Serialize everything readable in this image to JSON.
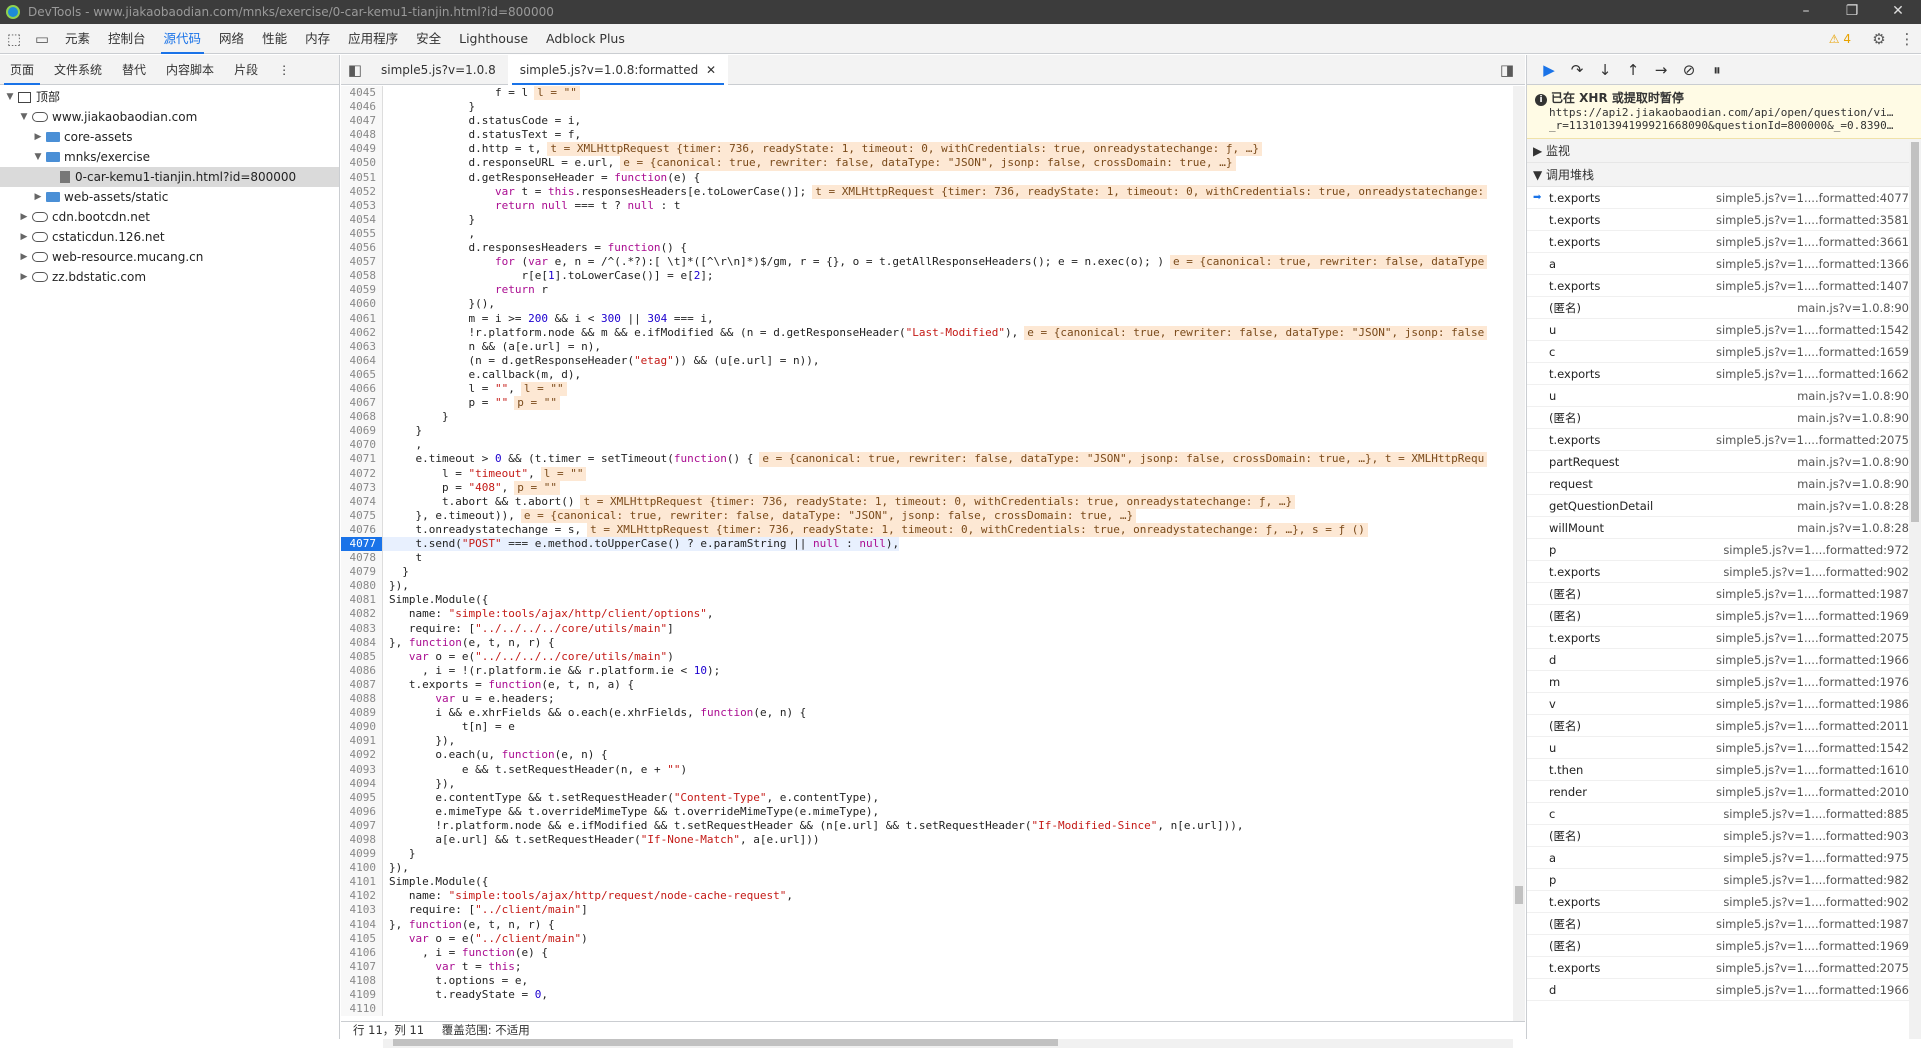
{
  "window": {
    "title": "DevTools - www.jiakaobaodian.com/mnks/exercise/0-car-kemu1-tianjin.html?id=800000"
  },
  "toolbar": {
    "tabs": [
      "元素",
      "控制台",
      "源代码",
      "网络",
      "性能",
      "内存",
      "应用程序",
      "安全",
      "Lighthouse",
      "Adblock Plus"
    ],
    "active_tab": "源代码",
    "warnings": "4"
  },
  "navigator": {
    "tabs": [
      "页面",
      "文件系统",
      "替代",
      "内容脚本",
      "片段"
    ],
    "tree": [
      {
        "label": "顶部",
        "type": "top",
        "depth": 0,
        "arrow": "▼"
      },
      {
        "label": "www.jiakaobaodian.com",
        "type": "cloud",
        "depth": 1,
        "arrow": "▼"
      },
      {
        "label": "core-assets",
        "type": "folder",
        "depth": 2,
        "arrow": "▶"
      },
      {
        "label": "mnks/exercise",
        "type": "folder",
        "depth": 2,
        "arrow": "▼"
      },
      {
        "label": "0-car-kemu1-tianjin.html?id=800000",
        "type": "file",
        "depth": 3,
        "arrow": "",
        "selected": true
      },
      {
        "label": "web-assets/static",
        "type": "folder",
        "depth": 2,
        "arrow": "▶"
      },
      {
        "label": "cdn.bootcdn.net",
        "type": "cloud",
        "depth": 1,
        "arrow": "▶"
      },
      {
        "label": "cstaticdun.126.net",
        "type": "cloud",
        "depth": 1,
        "arrow": "▶"
      },
      {
        "label": "web-resource.mucang.cn",
        "type": "cloud",
        "depth": 1,
        "arrow": "▶"
      },
      {
        "label": "zz.bdstatic.com",
        "type": "cloud",
        "depth": 1,
        "arrow": "▶"
      }
    ]
  },
  "editor": {
    "tabs": [
      {
        "label": "simple5.js?v=1.0.8",
        "active": false,
        "closable": false
      },
      {
        "label": "simple5.js?v=1.0.8:formatted",
        "active": true,
        "closable": true
      }
    ],
    "current_line": 4077,
    "lines": [
      [
        "4045",
        "                f = l",
        "l = \"\""
      ],
      [
        "4046",
        "            }",
        ""
      ],
      [
        "4047",
        "            d.statusCode = i,",
        ""
      ],
      [
        "4048",
        "            d.statusText = f,",
        ""
      ],
      [
        "4049",
        "            d.http = t,",
        "t = XMLHttpRequest {timer: 736, readyState: 1, timeout: 0, withCredentials: true, onreadystatechange: ƒ, …}"
      ],
      [
        "4050",
        "            d.responseURL = e.url,",
        "e = {canonical: true, rewriter: false, dataType: \"JSON\", jsonp: false, crossDomain: true, …}"
      ],
      [
        "4051",
        "            d.getResponseHeader = function(e) {",
        ""
      ],
      [
        "4052",
        "                var t = this.responsesHeaders[e.toLowerCase()];",
        "t = XMLHttpRequest {timer: 736, readyState: 1, timeout: 0, withCredentials: true, onreadystatechange:"
      ],
      [
        "4053",
        "                return null === t ? null : t",
        ""
      ],
      [
        "4054",
        "            }",
        ""
      ],
      [
        "4055",
        "            ,",
        ""
      ],
      [
        "4056",
        "            d.responsesHeaders = function() {",
        ""
      ],
      [
        "4057",
        "                for (var e, n = /^(.*?):[ \\t]*([^\\r\\n]*)$/gm, r = {}, o = t.getAllResponseHeaders(); e = n.exec(o); )",
        "e = {canonical: true, rewriter: false, dataType"
      ],
      [
        "4058",
        "                    r[e[1].toLowerCase()] = e[2];",
        ""
      ],
      [
        "4059",
        "                return r",
        ""
      ],
      [
        "4060",
        "            }(),",
        ""
      ],
      [
        "4061",
        "            m = i >= 200 && i < 300 || 304 === i,",
        ""
      ],
      [
        "4062",
        "            !r.platform.node && m && e.ifModified && (n = d.getResponseHeader(\"Last-Modified\"),",
        "e = {canonical: true, rewriter: false, dataType: \"JSON\", jsonp: false"
      ],
      [
        "4063",
        "            n && (a[e.url] = n),",
        ""
      ],
      [
        "4064",
        "            (n = d.getResponseHeader(\"etag\")) && (u[e.url] = n)),",
        ""
      ],
      [
        "4065",
        "            e.callback(m, d),",
        ""
      ],
      [
        "4066",
        "            l = \"\",",
        "l = \"\""
      ],
      [
        "4067",
        "            p = \"\"",
        "p = \"\""
      ],
      [
        "4068",
        "        }",
        ""
      ],
      [
        "4069",
        "    }",
        ""
      ],
      [
        "4070",
        "    ,",
        ""
      ],
      [
        "4071",
        "    e.timeout > 0 && (t.timer = setTimeout(function() {",
        "e = {canonical: true, rewriter: false, dataType: \"JSON\", jsonp: false, crossDomain: true, …}, t = XMLHttpRequ"
      ],
      [
        "4072",
        "        l = \"timeout\",",
        "l = \"\""
      ],
      [
        "4073",
        "        p = \"408\",",
        "p = \"\""
      ],
      [
        "4074",
        "        t.abort && t.abort()",
        "t = XMLHttpRequest {timer: 736, readyState: 1, timeout: 0, withCredentials: true, onreadystatechange: ƒ, …}"
      ],
      [
        "4075",
        "    }, e.timeout)),",
        "e = {canonical: true, rewriter: false, dataType: \"JSON\", jsonp: false, crossDomain: true, …}"
      ],
      [
        "4076",
        "    t.onreadystatechange = s,",
        "t = XMLHttpRequest {timer: 736, readyState: 1, timeout: 0, withCredentials: true, onreadystatechange: ƒ, …}, s = ƒ ()"
      ],
      [
        "4077",
        "    t.send(\"POST\" === e.method.toUpperCase() ? e.paramString || null : null),",
        ""
      ],
      [
        "4078",
        "    t",
        ""
      ],
      [
        "4079",
        "  }",
        ""
      ],
      [
        "4080",
        "}),",
        ""
      ],
      [
        "4081",
        "Simple.Module({",
        ""
      ],
      [
        "4082",
        "   name: \"simple:tools/ajax/http/client/options\",",
        ""
      ],
      [
        "4083",
        "   require: [\"../../../../core/utils/main\"]",
        ""
      ],
      [
        "4084",
        "}, function(e, t, n, r) {",
        ""
      ],
      [
        "4085",
        "   var o = e(\"../../../../core/utils/main\")",
        ""
      ],
      [
        "4086",
        "     , i = !(r.platform.ie && r.platform.ie < 10);",
        ""
      ],
      [
        "4087",
        "   t.exports = function(e, t, n, a) {",
        ""
      ],
      [
        "4088",
        "       var u = e.headers;",
        ""
      ],
      [
        "4089",
        "       i && e.xhrFields && o.each(e.xhrFields, function(e, n) {",
        ""
      ],
      [
        "4090",
        "           t[n] = e",
        ""
      ],
      [
        "4091",
        "       }),",
        ""
      ],
      [
        "4092",
        "       o.each(u, function(e, n) {",
        ""
      ],
      [
        "4093",
        "           e && t.setRequestHeader(n, e + \"\")",
        ""
      ],
      [
        "4094",
        "       }),",
        ""
      ],
      [
        "4095",
        "       e.contentType && t.setRequestHeader(\"Content-Type\", e.contentType),",
        ""
      ],
      [
        "4096",
        "       e.mimeType && t.overrideMimeType && t.overrideMimeType(e.mimeType),",
        ""
      ],
      [
        "4097",
        "       !r.platform.node && e.ifModified && t.setRequestHeader && (n[e.url] && t.setRequestHeader(\"If-Modified-Since\", n[e.url])),",
        ""
      ],
      [
        "4098",
        "       a[e.url] && t.setRequestHeader(\"If-None-Match\", a[e.url]))",
        ""
      ],
      [
        "4099",
        "   }",
        ""
      ],
      [
        "4100",
        "}),",
        ""
      ],
      [
        "4101",
        "Simple.Module({",
        ""
      ],
      [
        "4102",
        "   name: \"simple:tools/ajax/http/request/node-cache-request\",",
        ""
      ],
      [
        "4103",
        "   require: [\"../client/main\"]",
        ""
      ],
      [
        "4104",
        "}, function(e, t, n, r) {",
        ""
      ],
      [
        "4105",
        "   var o = e(\"../client/main\")",
        ""
      ],
      [
        "4106",
        "     , i = function(e) {",
        ""
      ],
      [
        "4107",
        "       var t = this;",
        ""
      ],
      [
        "4108",
        "       t.options = e,",
        ""
      ],
      [
        "4109",
        "       t.readyState = 0,",
        ""
      ],
      [
        "4110",
        "",
        ""
      ]
    ]
  },
  "status": {
    "position": "行 11，列 11",
    "coverage": "覆盖范围: 不适用"
  },
  "debugger": {
    "pause_title": "已在 XHR 或提取时暂停",
    "pause_url1": "https://api2.jiakaobaodian.com/api/open/question/vi…",
    "pause_url2": "_r=113101394199921668090&questionId=800000&_=0.8390…",
    "watch_label": "监视",
    "callstack_label": "调用堆栈",
    "frames": [
      {
        "fn": "t.exports",
        "loc": "simple5.js?v=1....formatted:4077",
        "current": true
      },
      {
        "fn": "t.exports",
        "loc": "simple5.js?v=1....formatted:3581"
      },
      {
        "fn": "t.exports",
        "loc": "simple5.js?v=1....formatted:3661"
      },
      {
        "fn": "a",
        "loc": "simple5.js?v=1....formatted:1366"
      },
      {
        "fn": "t.exports",
        "loc": "simple5.js?v=1....formatted:1407"
      },
      {
        "fn": "(匿名)",
        "loc": "main.js?v=1.0.8:90"
      },
      {
        "fn": "u",
        "loc": "simple5.js?v=1....formatted:1542"
      },
      {
        "fn": "c",
        "loc": "simple5.js?v=1....formatted:1659"
      },
      {
        "fn": "t.exports",
        "loc": "simple5.js?v=1....formatted:1662"
      },
      {
        "fn": "u",
        "loc": "main.js?v=1.0.8:90"
      },
      {
        "fn": "(匿名)",
        "loc": "main.js?v=1.0.8:90"
      },
      {
        "fn": "t.exports",
        "loc": "simple5.js?v=1....formatted:2075"
      },
      {
        "fn": "partRequest",
        "loc": "main.js?v=1.0.8:90"
      },
      {
        "fn": "request",
        "loc": "main.js?v=1.0.8:90"
      },
      {
        "fn": "getQuestionDetail",
        "loc": "main.js?v=1.0.8:28"
      },
      {
        "fn": "willMount",
        "loc": "main.js?v=1.0.8:28"
      },
      {
        "fn": "p",
        "loc": "simple5.js?v=1....formatted:972"
      },
      {
        "fn": "t.exports",
        "loc": "simple5.js?v=1....formatted:902"
      },
      {
        "fn": "(匿名)",
        "loc": "simple5.js?v=1....formatted:1987"
      },
      {
        "fn": "(匿名)",
        "loc": "simple5.js?v=1....formatted:1969"
      },
      {
        "fn": "t.exports",
        "loc": "simple5.js?v=1....formatted:2075"
      },
      {
        "fn": "d",
        "loc": "simple5.js?v=1....formatted:1966"
      },
      {
        "fn": "m",
        "loc": "simple5.js?v=1....formatted:1976"
      },
      {
        "fn": "v",
        "loc": "simple5.js?v=1....formatted:1986"
      },
      {
        "fn": "(匿名)",
        "loc": "simple5.js?v=1....formatted:2011"
      },
      {
        "fn": "u",
        "loc": "simple5.js?v=1....formatted:1542"
      },
      {
        "fn": "t.then",
        "loc": "simple5.js?v=1....formatted:1610"
      },
      {
        "fn": "render",
        "loc": "simple5.js?v=1....formatted:2010"
      },
      {
        "fn": "c",
        "loc": "simple5.js?v=1....formatted:885"
      },
      {
        "fn": "(匿名)",
        "loc": "simple5.js?v=1....formatted:903"
      },
      {
        "fn": "a",
        "loc": "simple5.js?v=1....formatted:975"
      },
      {
        "fn": "p",
        "loc": "simple5.js?v=1....formatted:982"
      },
      {
        "fn": "t.exports",
        "loc": "simple5.js?v=1....formatted:902"
      },
      {
        "fn": "(匿名)",
        "loc": "simple5.js?v=1....formatted:1987"
      },
      {
        "fn": "(匿名)",
        "loc": "simple5.js?v=1....formatted:1969"
      },
      {
        "fn": "t.exports",
        "loc": "simple5.js?v=1....formatted:2075"
      },
      {
        "fn": "d",
        "loc": "simple5.js?v=1....formatted:1966"
      }
    ]
  }
}
